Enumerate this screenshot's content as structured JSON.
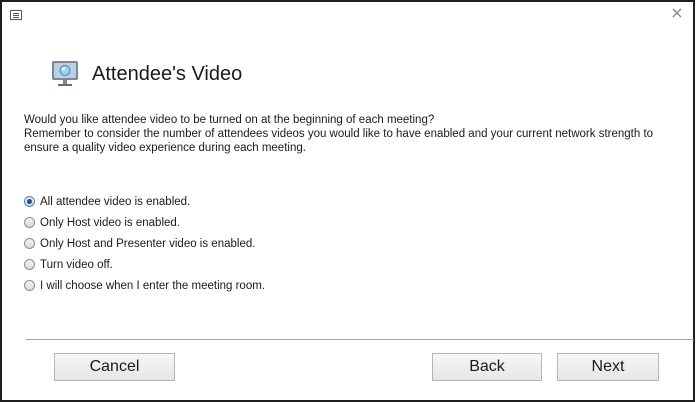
{
  "window": {
    "close_glyph": "×"
  },
  "header": {
    "title": "Attendee's Video",
    "icon": "monitor-icon"
  },
  "description": {
    "line1": "Would you like attendee video to be turned on at the beginning of each meeting?",
    "line2": "Remember to consider the number of attendees videos you would like to have enabled and your current network strength to ensure a quality video experience during each meeting."
  },
  "options": [
    {
      "label": "All attendee video is enabled.",
      "checked": true
    },
    {
      "label": "Only Host video is enabled.",
      "checked": false
    },
    {
      "label": "Only Host and Presenter video is enabled.",
      "checked": false
    },
    {
      "label": "Turn video off.",
      "checked": false
    },
    {
      "label": "I will choose when I enter the meeting room.",
      "checked": false
    }
  ],
  "buttons": {
    "cancel": "Cancel",
    "back": "Back",
    "next": "Next"
  },
  "colors": {
    "radio_selected": "#1f4f8a",
    "window_border": "#1e1e1e"
  }
}
